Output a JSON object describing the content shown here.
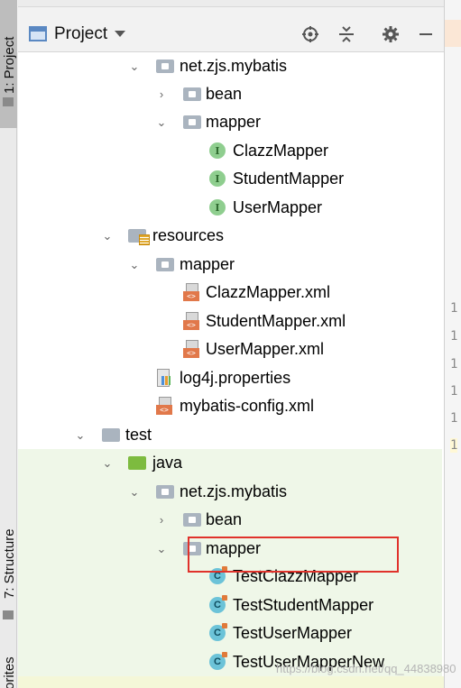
{
  "header": {
    "title": "Project"
  },
  "sidebar": {
    "project_tab": "1: Project",
    "structure_tab": "7: Structure",
    "favorites_tab": "orites"
  },
  "tree": [
    {
      "label": "net.zjs.mybatis",
      "icon": "package-folder-icon",
      "arrow": "expanded"
    },
    {
      "label": "bean",
      "icon": "package-folder-icon",
      "arrow": "collapsed"
    },
    {
      "label": "mapper",
      "icon": "package-folder-icon",
      "arrow": "expanded"
    },
    {
      "label": "ClazzMapper",
      "icon": "interface-icon"
    },
    {
      "label": "StudentMapper",
      "icon": "interface-icon"
    },
    {
      "label": "UserMapper",
      "icon": "interface-icon"
    },
    {
      "label": "resources",
      "icon": "resources-folder-icon",
      "arrow": "expanded"
    },
    {
      "label": "mapper",
      "icon": "package-folder-icon",
      "arrow": "expanded"
    },
    {
      "label": "ClazzMapper.xml",
      "icon": "xml-file-icon"
    },
    {
      "label": "StudentMapper.xml",
      "icon": "xml-file-icon"
    },
    {
      "label": "UserMapper.xml",
      "icon": "xml-file-icon"
    },
    {
      "label": "log4j.properties",
      "icon": "properties-file-icon"
    },
    {
      "label": "mybatis-config.xml",
      "icon": "xml-file-icon"
    },
    {
      "label": "test",
      "icon": "folder-icon",
      "arrow": "expanded"
    },
    {
      "label": "java",
      "icon": "test-source-folder-icon",
      "arrow": "expanded"
    },
    {
      "label": "net.zjs.mybatis",
      "icon": "package-folder-icon",
      "arrow": "expanded"
    },
    {
      "label": "bean",
      "icon": "package-folder-icon",
      "arrow": "collapsed"
    },
    {
      "label": "mapper",
      "icon": "package-folder-icon",
      "arrow": "expanded"
    },
    {
      "label": "TestClazzMapper",
      "icon": "test-class-icon"
    },
    {
      "label": "TestStudentMapper",
      "icon": "test-class-icon",
      "highlighted": true
    },
    {
      "label": "TestUserMapper",
      "icon": "test-class-icon"
    },
    {
      "label": "TestUserMapperNew",
      "icon": "test-class-icon"
    }
  ],
  "gutter": [
    "1",
    "1",
    "1",
    "1",
    "1",
    "1"
  ],
  "watermark": "https://blog.csdn.net/qq_44838980",
  "icons": {
    "interface_letter": "I",
    "class_letter": "C"
  },
  "colors": {
    "highlight_border": "#e0322b",
    "test_background": "#eff7e8"
  }
}
